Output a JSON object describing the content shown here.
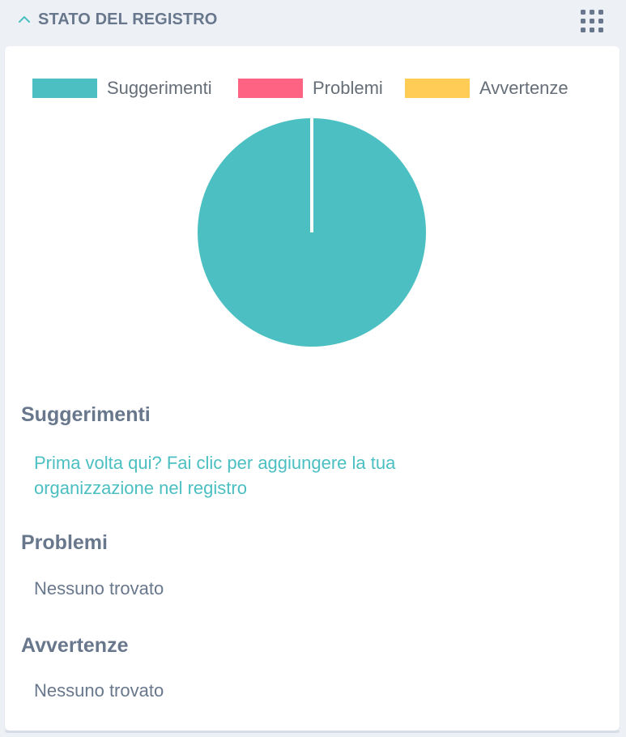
{
  "header": {
    "title": "STATO DEL REGISTRO"
  },
  "colors": {
    "accent": "#4bbfc1",
    "problems": "#ff6384",
    "warnings": "#ffcd56"
  },
  "chart_data": {
    "type": "pie",
    "legend": [
      "Suggerimenti",
      "Problemi",
      "Avvertenze"
    ],
    "legend_position": "top",
    "categories": [
      "Suggerimenti",
      "Problemi",
      "Avvertenze"
    ],
    "values": [
      1,
      0,
      0
    ],
    "colors": [
      "#4bbfc1",
      "#ff6384",
      "#ffcd56"
    ]
  },
  "sections": {
    "suggestions": {
      "title": "Suggerimenti",
      "link": "Prima volta qui? Fai clic per aggiungere la tua organizzazione nel registro"
    },
    "problems": {
      "title": "Problemi",
      "text": "Nessuno trovato"
    },
    "warnings": {
      "title": "Avvertenze",
      "text": "Nessuno trovato"
    }
  }
}
